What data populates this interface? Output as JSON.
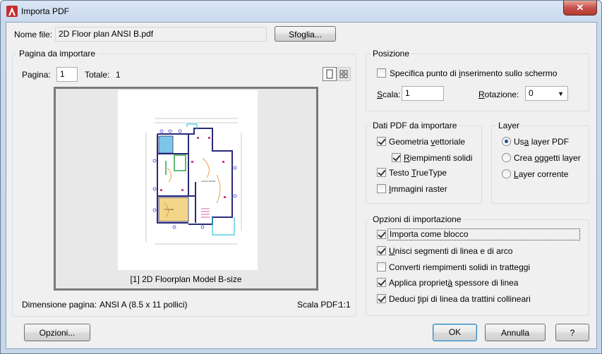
{
  "window": {
    "title": "Importa PDF",
    "close_glyph": "✕"
  },
  "file": {
    "label": "Nome file:",
    "value": "2D Floor plan ANSI B.pdf",
    "browse_label": "Sfoglia..."
  },
  "page_group": {
    "title": "Pagina da importare",
    "page_label": "Pagina:",
    "page_value": "1",
    "total_label": "Totale:",
    "total_value": "1",
    "preview_caption": "[1] 2D Floorplan Model B-size",
    "size_label": "Dimensione pagina:",
    "size_value": "ANSI A (8.5 x 11 pollici)",
    "scale_label": "Scala PDF:",
    "scale_value": "1:1"
  },
  "position_group": {
    "title": "Posizione",
    "specify_label": "Specifica punto di inserimento sullo schermo",
    "specify_checked": false,
    "scale_label": "Scala:",
    "scale_value": "1",
    "rotation_label": "Rotazione:",
    "rotation_value": "0"
  },
  "pdf_data_group": {
    "title": "Dati PDF da importare",
    "items": [
      {
        "label": "Geometria vettoriale",
        "checked": true
      },
      {
        "label": "Riempimenti solidi",
        "checked": true
      },
      {
        "label": "Testo TrueType",
        "checked": true
      },
      {
        "label": "Immagini raster",
        "checked": false
      }
    ]
  },
  "layer_group": {
    "title": "Layer",
    "options": [
      {
        "label": "Usa layer PDF",
        "selected": true
      },
      {
        "label": "Crea oggetti layer",
        "selected": false
      },
      {
        "label": "Layer corrente",
        "selected": false
      }
    ]
  },
  "import_options_group": {
    "title": "Opzioni di importazione",
    "items": [
      {
        "label": "Importa come blocco",
        "checked": true
      },
      {
        "label": "Unisci segmenti di linea e di arco",
        "checked": true
      },
      {
        "label": "Converti riempimenti solidi in tratteggi",
        "checked": false
      },
      {
        "label": "Applica proprietà spessore di linea",
        "checked": true
      },
      {
        "label": "Deduci tipi di linea da trattini collineari",
        "checked": true
      }
    ]
  },
  "buttons": {
    "options": "Opzioni...",
    "ok": "OK",
    "cancel": "Annulla",
    "help": "?"
  },
  "colors": {
    "accent": "#c62e2e",
    "selection": "#1d4f8c"
  }
}
